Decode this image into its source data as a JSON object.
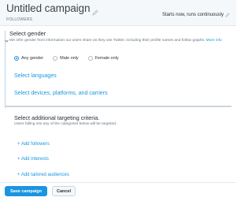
{
  "header": {
    "campaign_title": "Untitled campaign",
    "subtitle": "FOLLOWERS",
    "schedule_text": "Starts now, runs continuously"
  },
  "gender": {
    "title": "Select gender",
    "description": "We infer gender from information our users share as they use Twitter, including their profile names and follow graphs.",
    "more_info": "More info",
    "options": [
      {
        "label": "Any gender",
        "checked": true
      },
      {
        "label": "Male only",
        "checked": false
      },
      {
        "label": "Female only",
        "checked": false
      }
    ]
  },
  "sections": {
    "languages": "Select languages",
    "devices": "Select devices, platforms, and carriers"
  },
  "targeting": {
    "title": "Select additional targeting criteria.",
    "description": "Users falling into any of the categories below will be targeted.",
    "add_followers": "+ Add followers",
    "add_interests": "+ Add interests",
    "add_tailored": "+ Add tailored audiences"
  },
  "footer": {
    "save_label": "Save campaign",
    "cancel_label": "Cancel"
  },
  "colors": {
    "accent": "#1b95e0",
    "text": "#292f33",
    "muted": "#66757f"
  }
}
